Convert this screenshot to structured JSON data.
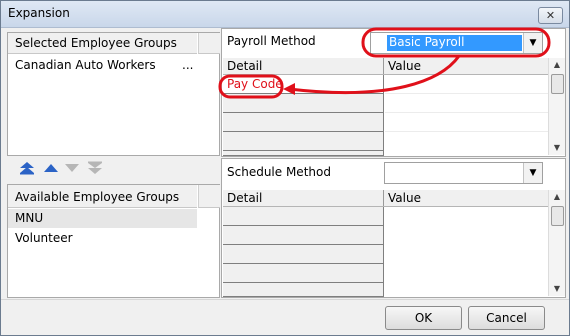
{
  "window": {
    "title": "Expansion",
    "close_label": "✕"
  },
  "left": {
    "selected_header": "Selected Employee Groups",
    "selected_items": [
      {
        "label": "Canadian Auto Workers",
        "more": "..."
      }
    ],
    "available_header": "Available Employee Groups",
    "available_items": [
      {
        "label": "MNU"
      },
      {
        "label": "Volunteer"
      }
    ]
  },
  "payroll": {
    "label": "Payroll Method",
    "selected": "Basic Payroll",
    "detail_header": "Detail",
    "value_header": "Value",
    "rows": [
      "Pay Code"
    ]
  },
  "schedule": {
    "label": "Schedule Method",
    "selected": "",
    "detail_header": "Detail",
    "value_header": "Value"
  },
  "buttons": {
    "ok": "OK",
    "cancel": "Cancel"
  },
  "colors": {
    "annotation": "#e0101a",
    "selection": "#3399ff"
  }
}
